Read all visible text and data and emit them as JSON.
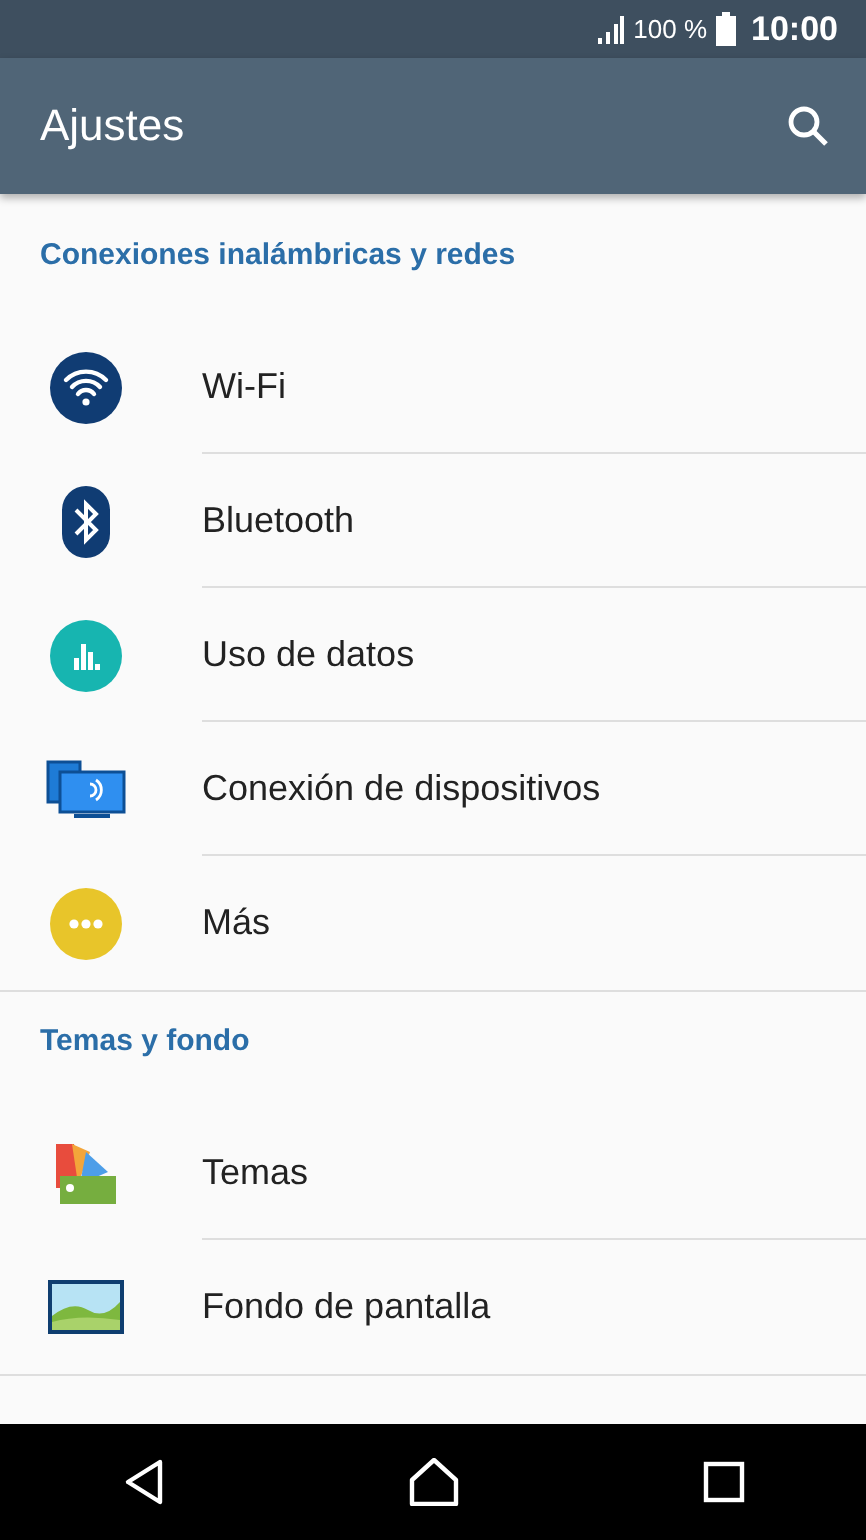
{
  "status_bar": {
    "battery_percent": "100 %",
    "time": "10:00"
  },
  "app_bar": {
    "title": "Ajustes"
  },
  "sections": [
    {
      "title": "Conexiones inalámbricas y redes",
      "items": [
        {
          "label": "Wi-Fi"
        },
        {
          "label": "Bluetooth"
        },
        {
          "label": "Uso de datos"
        },
        {
          "label": "Conexión de dispositivos"
        },
        {
          "label": "Más"
        }
      ]
    },
    {
      "title": "Temas y fondo",
      "items": [
        {
          "label": "Temas"
        },
        {
          "label": "Fondo de pantalla"
        }
      ]
    }
  ]
}
